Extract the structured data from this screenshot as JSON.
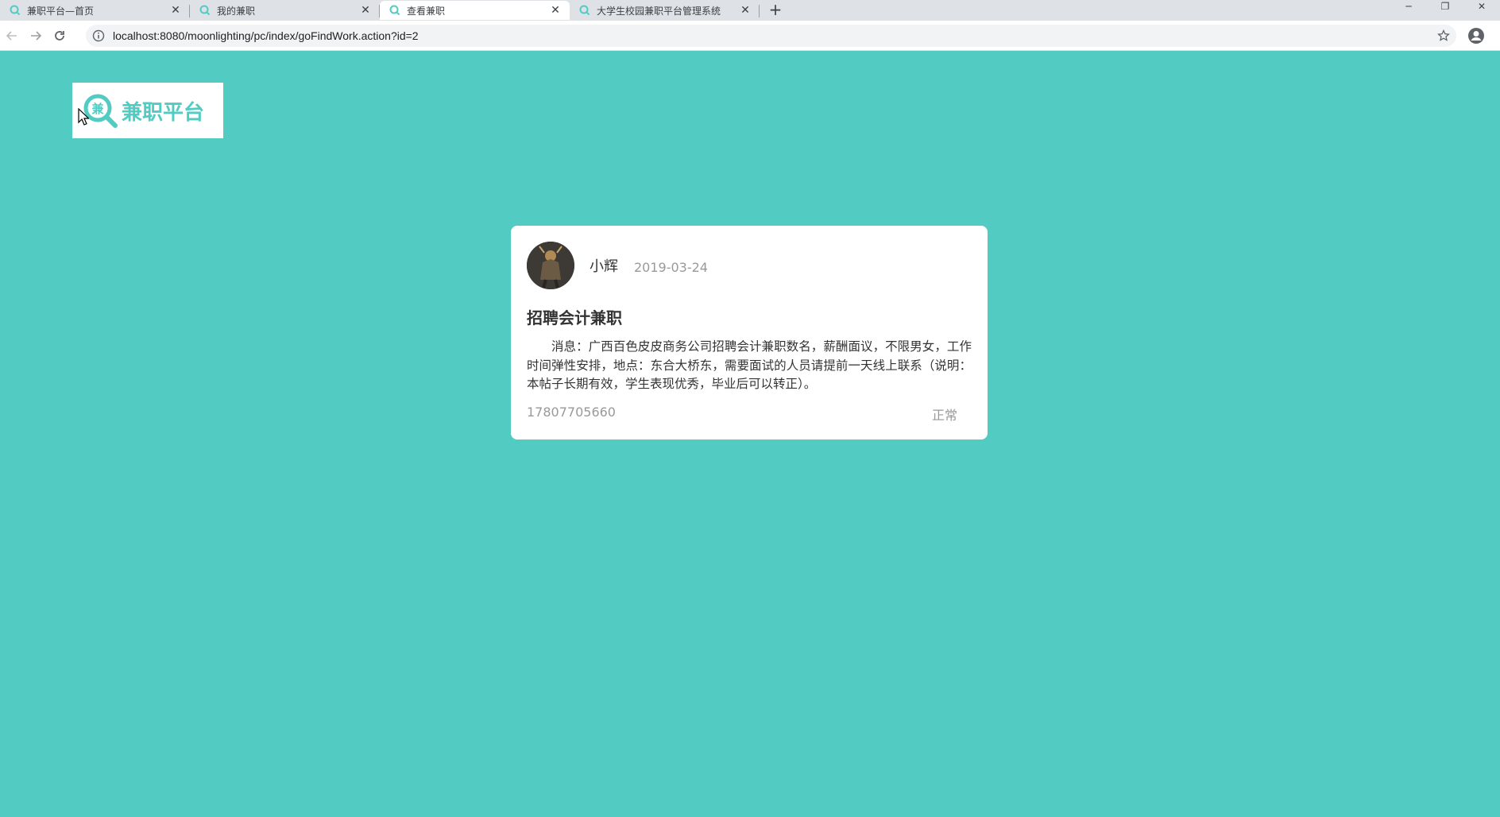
{
  "browser": {
    "tabs": [
      {
        "title": "兼职平台—首页",
        "active": false
      },
      {
        "title": "我的兼职",
        "active": false
      },
      {
        "title": "查看兼职",
        "active": true
      },
      {
        "title": "大学生校园兼职平台管理系统",
        "active": false
      }
    ],
    "new_tab_label": "+",
    "close_label": "✕",
    "window_controls": {
      "minimize": "─",
      "restore": "❐",
      "close": "✕"
    },
    "url": "localhost:8080/moonlighting/pc/index/goFindWork.action?id=2",
    "accent_color": "#52cbc3"
  },
  "page": {
    "background_color": "#52cbc3",
    "logo": {
      "mark_char": "兼",
      "text": "兼职平台"
    },
    "post": {
      "author": "小辉",
      "date": "2019-03-24",
      "title": "招聘会计兼职",
      "description": "消息：广西百色皮皮商务公司招聘会计兼职数名，薪酬面议，不限男女，工作时间弹性安排，地点：东合大桥东，需要面试的人员请提前一天线上联系（说明：本帖子长期有效，学生表现优秀，毕业后可以转正）。",
      "phone": "17807705660",
      "status": "正常"
    }
  }
}
